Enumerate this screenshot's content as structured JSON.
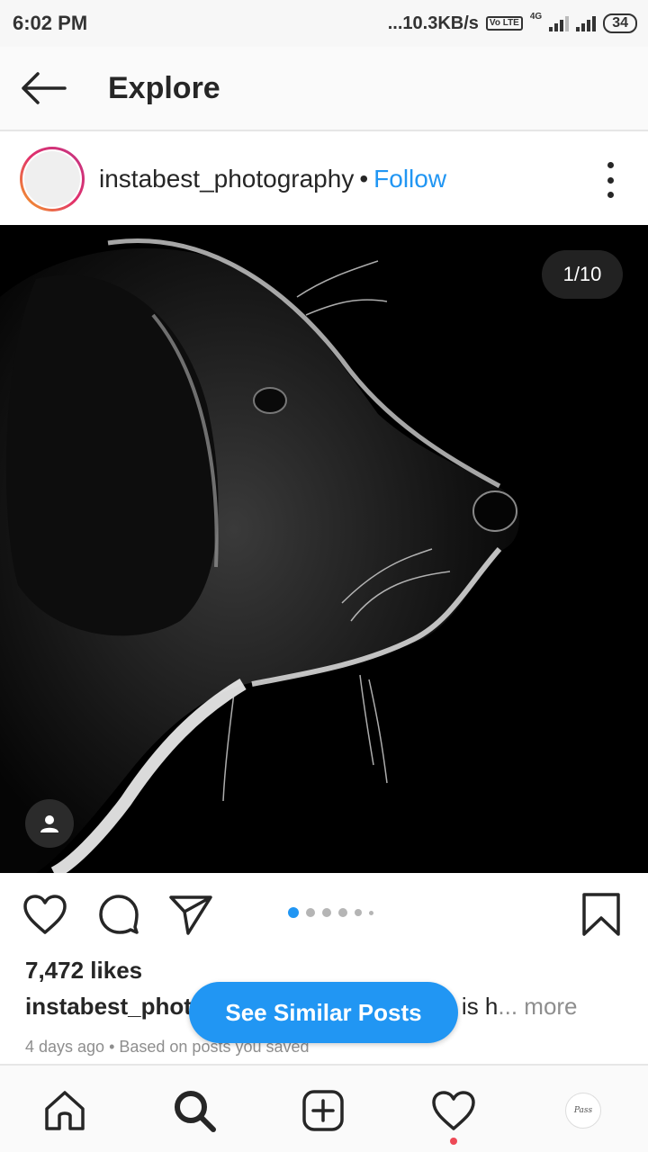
{
  "status_bar": {
    "time": "6:02 PM",
    "speed": "...10.3KB/s",
    "volte": "Vo LTE",
    "network": "4G",
    "battery": "34"
  },
  "header": {
    "title": "Explore",
    "back_icon": "back-arrow-icon"
  },
  "post": {
    "username": "instabest_photography",
    "separator": "•",
    "follow_label": "Follow",
    "image_counter": "1/10",
    "likes": "7,472 likes",
    "caption_user": "instabest_phot",
    "caption_tail": "is h",
    "caption_more": "... more",
    "meta": "4 days ago • Based on posts you saved",
    "carousel_count": 6,
    "carousel_active": 0
  },
  "overlay_button": {
    "label": "See Similar Posts"
  },
  "bottom_nav": {
    "items": [
      "home-icon",
      "search-icon",
      "new-post-icon",
      "activity-icon",
      "profile-avatar"
    ],
    "profile_text": "Pass"
  },
  "colors": {
    "accent": "#2196f3",
    "notification": "#ed4956",
    "text": "#262626",
    "muted": "#8e8e8e"
  }
}
